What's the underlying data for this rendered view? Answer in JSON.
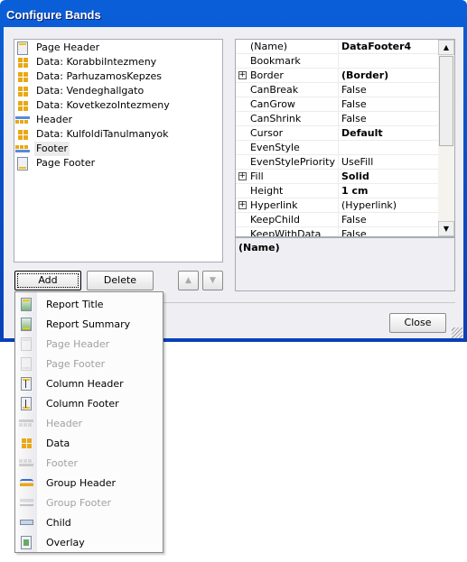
{
  "window": {
    "title": "Configure Bands"
  },
  "bands": [
    {
      "label": "Page Header",
      "icon": "page-header-icon"
    },
    {
      "label": "Data: KorabbiIntezmeny",
      "icon": "data-band-icon"
    },
    {
      "label": "Data: ParhuzamosKepzes",
      "icon": "data-band-icon"
    },
    {
      "label": "Data: Vendeghallgato",
      "icon": "data-band-icon"
    },
    {
      "label": "Data: KovetkezoIntezmeny",
      "icon": "data-band-icon"
    },
    {
      "label": "Header",
      "icon": "header-band-icon"
    },
    {
      "label": "Data: KulfoldiTanulmanyok",
      "icon": "data-band-icon"
    },
    {
      "label": "Footer",
      "icon": "footer-band-icon",
      "selected": true
    },
    {
      "label": "Page Footer",
      "icon": "page-footer-icon"
    }
  ],
  "properties": [
    {
      "name": "(Name)",
      "value": "DataFooter4",
      "bold": true
    },
    {
      "name": "Bookmark",
      "value": ""
    },
    {
      "name": "Border",
      "value": "(Border)",
      "bold": true,
      "expand": true
    },
    {
      "name": "CanBreak",
      "value": "False"
    },
    {
      "name": "CanGrow",
      "value": "False"
    },
    {
      "name": "CanShrink",
      "value": "False"
    },
    {
      "name": "Cursor",
      "value": "Default",
      "bold": true
    },
    {
      "name": "EvenStyle",
      "value": ""
    },
    {
      "name": "EvenStylePriority",
      "value": "UseFill"
    },
    {
      "name": "Fill",
      "value": "Solid",
      "bold": true,
      "expand": true
    },
    {
      "name": "Height",
      "value": "1 cm",
      "bold": true
    },
    {
      "name": "Hyperlink",
      "value": "(Hyperlink)",
      "expand": true
    },
    {
      "name": "KeepChild",
      "value": "False"
    },
    {
      "name": "KeepWithData",
      "value": "False"
    }
  ],
  "description": {
    "title": "(Name)"
  },
  "buttons": {
    "add": "Add",
    "delete": "Delete",
    "close": "Close",
    "up": "▲",
    "down": "▼"
  },
  "menu": [
    {
      "label": "Report Title",
      "enabled": true,
      "icon": "report-title-icon"
    },
    {
      "label": "Report Summary",
      "enabled": true,
      "icon": "report-summary-icon"
    },
    {
      "label": "Page Header",
      "enabled": false,
      "icon": "page-header-icon"
    },
    {
      "label": "Page Footer",
      "enabled": false,
      "icon": "page-footer-icon"
    },
    {
      "label": "Column Header",
      "enabled": true,
      "icon": "column-header-icon"
    },
    {
      "label": "Column Footer",
      "enabled": true,
      "icon": "column-footer-icon"
    },
    {
      "label": "Header",
      "enabled": false,
      "icon": "header-band-icon"
    },
    {
      "label": "Data",
      "enabled": true,
      "icon": "data-band-icon"
    },
    {
      "label": "Footer",
      "enabled": false,
      "icon": "footer-band-icon"
    },
    {
      "label": "Group Header",
      "enabled": true,
      "icon": "group-header-icon"
    },
    {
      "label": "Group Footer",
      "enabled": false,
      "icon": "group-footer-icon"
    },
    {
      "label": "Child",
      "enabled": true,
      "icon": "child-band-icon"
    },
    {
      "label": "Overlay",
      "enabled": true,
      "icon": "overlay-band-icon"
    }
  ]
}
